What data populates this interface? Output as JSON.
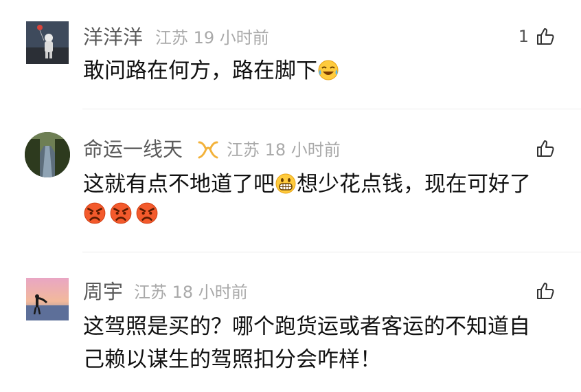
{
  "comments": [
    {
      "username": "洋洋洋",
      "location": "江苏",
      "time": "19 小时前",
      "like_count": "1",
      "text_part1": "敢问路在何方，路在脚下",
      "emoji": "laughing-crying-emoji"
    },
    {
      "username": "命运一线天",
      "badge": "vip-badge-icon",
      "location": "江苏",
      "time": "18 小时前",
      "like_count": "",
      "text_part1": "这就有点不地道了吧",
      "text_part2": "想少花点钱，现在可好了",
      "emoji_inline": "grinning-emoji",
      "emoji_row": [
        "angry-emoji",
        "angry-emoji",
        "angry-emoji"
      ]
    },
    {
      "username": "周宇",
      "location": "江苏",
      "time": "18 小时前",
      "like_count": "",
      "line1": "这驾照是买的？哪个跑货运或者客运的不知道自",
      "line2": "己赖以谋生的驾照扣分会咋样！"
    }
  ],
  "colors": {
    "username": "#5a5a5a",
    "meta": "#a9a9a9",
    "text": "#111111",
    "badge": "#f3b23a",
    "divider": "#ececec"
  }
}
